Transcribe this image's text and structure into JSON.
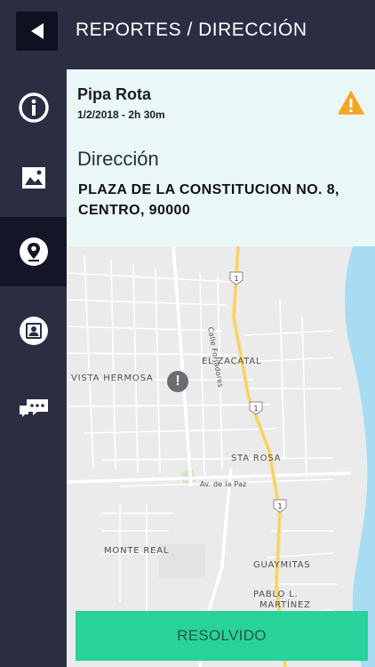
{
  "header": {
    "title": "REPORTES / DIRECCIÓN"
  },
  "sidebar": {
    "items": [
      {
        "icon": "info-icon",
        "active": false
      },
      {
        "icon": "image-icon",
        "active": false
      },
      {
        "icon": "location-pin-icon",
        "active": true
      },
      {
        "icon": "contact-card-icon",
        "active": false
      },
      {
        "icon": "chat-icon",
        "active": false
      }
    ]
  },
  "report": {
    "name": "Pipa Rota",
    "date": "1/2/2018 - 2h 30m",
    "status_icon": "warning-icon",
    "status_color": "#f5a623"
  },
  "address_section": {
    "label": "Dirección",
    "address": "PLAZA DE LA CONSTITUCION NO. 8, CENTRO, 90000"
  },
  "map": {
    "labels": {
      "calle": "Calle Forjadores",
      "zacatal": "EL ZACATAL",
      "vista": "VISTA HERMOSA",
      "starosa": "STA ROSA",
      "paz": "Av. de la Paz",
      "monte": "MONTE REAL",
      "guaymitas": "GUAYMITAS",
      "pablo": "PABLO L.",
      "martinez": "MARTÍNEZ"
    },
    "highway_shields": [
      "1",
      "1",
      "1"
    ],
    "marker_symbol": "!"
  },
  "actions": {
    "resolve_label": "RESOLVIDO"
  },
  "colors": {
    "nav_bg": "#2b2d42",
    "panel_bg": "#eaf7f7",
    "accent": "#28d29a",
    "water": "#a8dcf3"
  }
}
